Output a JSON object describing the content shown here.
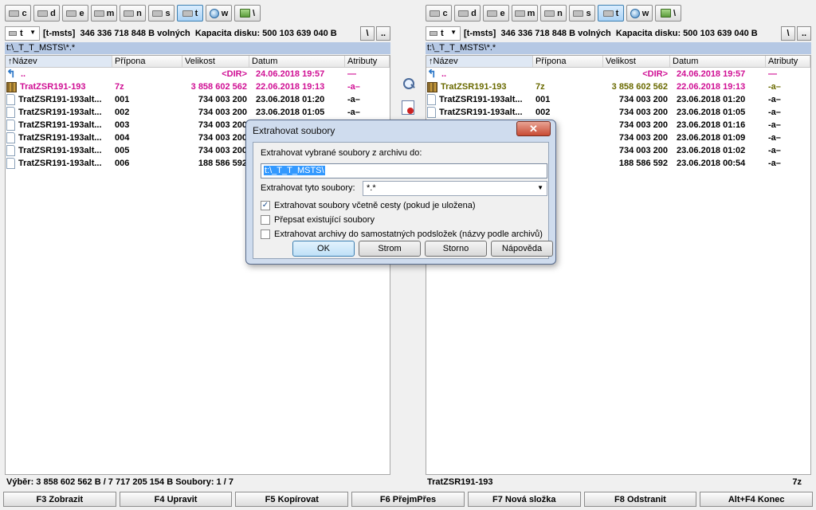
{
  "panels": {
    "left": {
      "drives": [
        {
          "letter": "c",
          "kind": "disk",
          "active": false
        },
        {
          "letter": "d",
          "kind": "disk",
          "active": false
        },
        {
          "letter": "e",
          "kind": "disk",
          "active": false
        },
        {
          "letter": "m",
          "kind": "disk",
          "active": false
        },
        {
          "letter": "n",
          "kind": "disk",
          "active": false
        },
        {
          "letter": "s",
          "kind": "disk",
          "active": false
        },
        {
          "letter": "t",
          "kind": "disk",
          "active": true
        },
        {
          "letter": "w",
          "kind": "net",
          "active": false
        },
        {
          "letter": "\\",
          "kind": "netdrv",
          "active": false
        }
      ],
      "drive_select": "t",
      "volume_label": "[t-msts]",
      "free_space": "346 336 718 848 B volných",
      "capacity": "Kapacita disku: 500 103 639 040 B",
      "root_button": "\\",
      "up_button": "..",
      "path": "t:\\_T_T_MSTS\\*.*",
      "status_left": "Výběr: 3 858 602 562 B / 7 717 205 154 B  Soubory: 1 / 7",
      "status_right": ""
    },
    "right": {
      "drives": [
        {
          "letter": "c",
          "kind": "disk",
          "active": false
        },
        {
          "letter": "d",
          "kind": "disk",
          "active": false
        },
        {
          "letter": "e",
          "kind": "disk",
          "active": false
        },
        {
          "letter": "m",
          "kind": "disk",
          "active": false
        },
        {
          "letter": "n",
          "kind": "disk",
          "active": false
        },
        {
          "letter": "s",
          "kind": "disk",
          "active": false
        },
        {
          "letter": "t",
          "kind": "disk",
          "active": true
        },
        {
          "letter": "w",
          "kind": "net",
          "active": false
        },
        {
          "letter": "\\",
          "kind": "netdrv",
          "active": false
        }
      ],
      "drive_select": "t",
      "volume_label": "[t-msts]",
      "free_space": "346 336 718 848 B volných",
      "capacity": "Kapacita disku: 500 103 639 040 B",
      "root_button": "\\",
      "up_button": "..",
      "path": "t:\\_T_T_MSTS\\*.*",
      "status_left": "TratZSR191-193",
      "status_right": "7z"
    }
  },
  "columns": {
    "name": "↑Název",
    "ext": "Přípona",
    "size": "Velikost",
    "date": "Datum",
    "attr": "Atributy"
  },
  "files_left": [
    {
      "type": "up",
      "name": "..",
      "ext": "",
      "size": "<DIR>",
      "date": "24.06.2018 19:57",
      "attr": "—"
    },
    {
      "type": "arch",
      "name": "TratZSR191-193",
      "ext": "7z",
      "size": "3 858 602 562",
      "date": "22.06.2018 19:13",
      "attr": "-a–"
    },
    {
      "type": "file",
      "name": "TratZSR191-193alt...",
      "ext": "001",
      "size": "734 003 200",
      "date": "23.06.2018 01:20",
      "attr": "-a–"
    },
    {
      "type": "file",
      "name": "TratZSR191-193alt...",
      "ext": "002",
      "size": "734 003 200",
      "date": "23.06.2018 01:05",
      "attr": "-a–"
    },
    {
      "type": "file",
      "name": "TratZSR191-193alt...",
      "ext": "003",
      "size": "734 003 200",
      "date": "",
      "attr": ""
    },
    {
      "type": "file",
      "name": "TratZSR191-193alt...",
      "ext": "004",
      "size": "734 003 200",
      "date": "",
      "attr": ""
    },
    {
      "type": "file",
      "name": "TratZSR191-193alt...",
      "ext": "005",
      "size": "734 003 200",
      "date": "",
      "attr": ""
    },
    {
      "type": "file",
      "name": "TratZSR191-193alt...",
      "ext": "006",
      "size": "188 586 592",
      "date": "",
      "attr": ""
    }
  ],
  "files_right": [
    {
      "type": "up",
      "name": "..",
      "ext": "",
      "size": "<DIR>",
      "date": "24.06.2018 19:57",
      "attr": "—"
    },
    {
      "type": "arch",
      "name": "TratZSR191-193",
      "ext": "7z",
      "size": "3 858 602 562",
      "date": "22.06.2018 19:13",
      "attr": "-a–"
    },
    {
      "type": "file",
      "name": "TratZSR191-193alt...",
      "ext": "001",
      "size": "734 003 200",
      "date": "23.06.2018 01:20",
      "attr": "-a–"
    },
    {
      "type": "file",
      "name": "TratZSR191-193alt...",
      "ext": "002",
      "size": "734 003 200",
      "date": "23.06.2018 01:05",
      "attr": "-a–"
    },
    {
      "type": "file",
      "name": "",
      "ext": "",
      "size": "734 003 200",
      "date": "23.06.2018 01:16",
      "attr": "-a–"
    },
    {
      "type": "file",
      "name": "",
      "ext": "",
      "size": "734 003 200",
      "date": "23.06.2018 01:09",
      "attr": "-a–"
    },
    {
      "type": "file",
      "name": "",
      "ext": "",
      "size": "734 003 200",
      "date": "23.06.2018 01:02",
      "attr": "-a–"
    },
    {
      "type": "file",
      "name": "",
      "ext": "",
      "size": "188 586 592",
      "date": "23.06.2018 00:54",
      "attr": "-a–"
    }
  ],
  "dialog": {
    "title": "Extrahovat soubory",
    "close": "✕",
    "dest_label": "Extrahovat vybrané soubory z archivu do:",
    "dest_value": "t:\\_T_T_MSTS\\",
    "mask_label": "Extrahovat tyto soubory:",
    "mask_value": "*.*",
    "opt_paths": "Extrahovat soubory včetně cesty (pokud je uložena)",
    "opt_paths_checked": true,
    "opt_overwrite": "Přepsat existující soubory",
    "opt_overwrite_checked": false,
    "opt_subdirs": "Extrahovat archivy do samostatných podsložek (názvy podle archivů)",
    "opt_subdirs_checked": false,
    "btn_ok": "OK",
    "btn_tree": "Strom",
    "btn_cancel": "Storno",
    "btn_help": "Nápověda"
  },
  "fkeys": [
    "F3 Zobrazit",
    "F4 Upravit",
    "F5 Kopírovat",
    "F6 PřejmPřes",
    "F7 Nová složka",
    "F8 Odstranit",
    "Alt+F4 Konec"
  ]
}
